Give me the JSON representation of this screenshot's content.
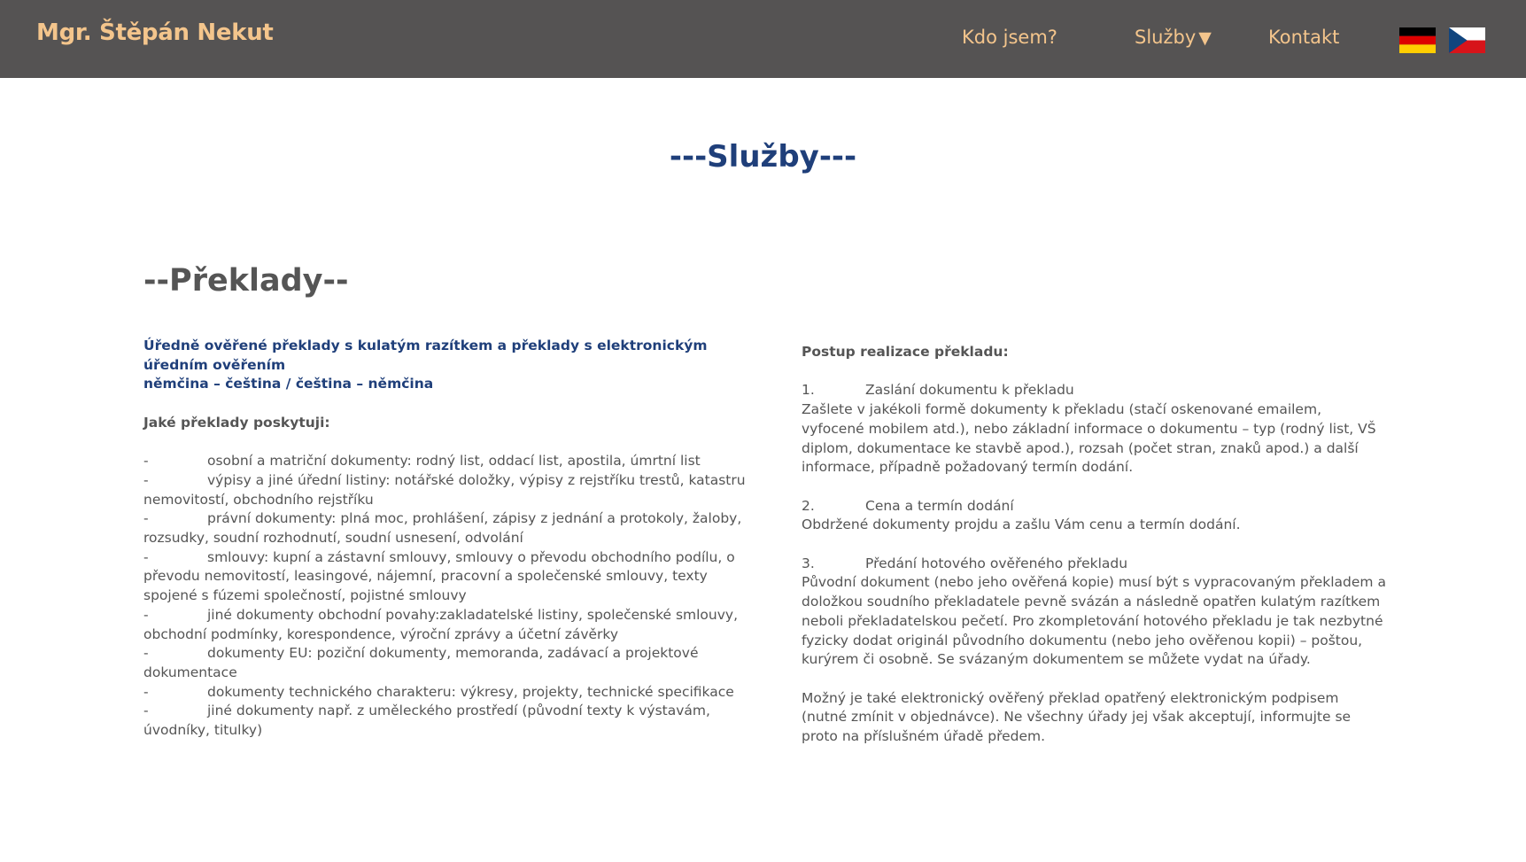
{
  "header": {
    "brand": "Mgr. Štěpán Nekut",
    "nav": {
      "about": "Kdo jsem?",
      "services": "Služby",
      "services_caret": "▼",
      "contact": "Kontakt"
    },
    "flags": {
      "german": "german-flag-icon",
      "czech": "czech-flag-icon"
    }
  },
  "main": {
    "title": "---Služby---",
    "section_heading": "--Překlady--",
    "left": {
      "intro_line1": "Úředně ověřené překlady s kulatým razítkem a překlady s elektronickým úředním ověřením",
      "intro_line2": "němčina – čeština / čeština – němčina",
      "question": "Jaké překlady poskytuji:",
      "bullet_marker": "-",
      "items": [
        "osobní a matriční dokumenty: rodný list, oddací list, apostila, úmrtní list",
        "výpisy a jiné úřední listiny: notářské doložky, výpisy z rejstříku trestů, katastru nemovitostí, obchodního rejstříku",
        "právní dokumenty: plná moc, prohlášení, zápisy z jednání a protokoly, žaloby, rozsudky, soudní rozhodnutí, soudní usnesení, odvolání",
        "smlouvy: kupní a zástavní smlouvy, smlouvy o převodu obchodního podílu, o převodu nemovitostí, leasingové, nájemní, pracovní a společenské smlouvy, texty spojené s fúzemi společností, pojistné smlouvy",
        "jiné dokumenty obchodní povahy:zakladatelské listiny, společenské smlouvy, obchodní podmínky, korespondence, výroční zprávy a účetní závěrky",
        "dokumenty EU: poziční dokumenty, memoranda, zadávací a projektové dokumentace",
        "dokumenty technického charakteru: výkresy, projekty, technické specifikace",
        "jiné dokumenty např. z uměleckého prostředí (původní texty k výstavám, úvodníky, titulky)"
      ]
    },
    "right": {
      "heading": "Postup realizace překladu:",
      "steps": [
        {
          "number": "1.",
          "title": "Zaslání dokumentu k překladu",
          "text": "Zašlete v jakékoli formě dokumenty k překladu (stačí oskenované emailem, vyfocené mobilem atd.), nebo základní informace o dokumentu – typ (rodný list, VŠ diplom, dokumentace ke stavbě apod.), rozsah (počet stran, znaků apod.) a další informace, případně požadovaný termín dodání."
        },
        {
          "number": "2.",
          "title": "Cena a termín dodání",
          "text": "Obdržené dokumenty projdu a zašlu Vám cenu a termín dodání."
        },
        {
          "number": "3.",
          "title": "Předání hotového ověřeného překladu",
          "text": "Původní dokument (nebo jeho ověřená kopie) musí být s vypracovaným překladem a doložkou soudního překladatele pevně svázán a následně opatřen kulatým razítkem neboli překladatelskou pečetí. Pro zkompletování hotového překladu je tak nezbytné fyzicky dodat originál původního dokumentu (nebo jeho ověřenou kopii) – poštou, kurýrem či osobně. Se svázaným dokumentem se můžete vydat na úřady."
        }
      ],
      "note": "Možný je také elektronický ověřený překlad opatřený elektronickým podpisem (nutné zmínit v objednávce). Ne všechny úřady jej však akceptují, informujte se proto na příslušném úřadě předem."
    }
  },
  "colors": {
    "header_bg": "#555353",
    "header_text": "#f4c58c",
    "title_blue": "#1f3f7a",
    "body_text": "#555555"
  }
}
